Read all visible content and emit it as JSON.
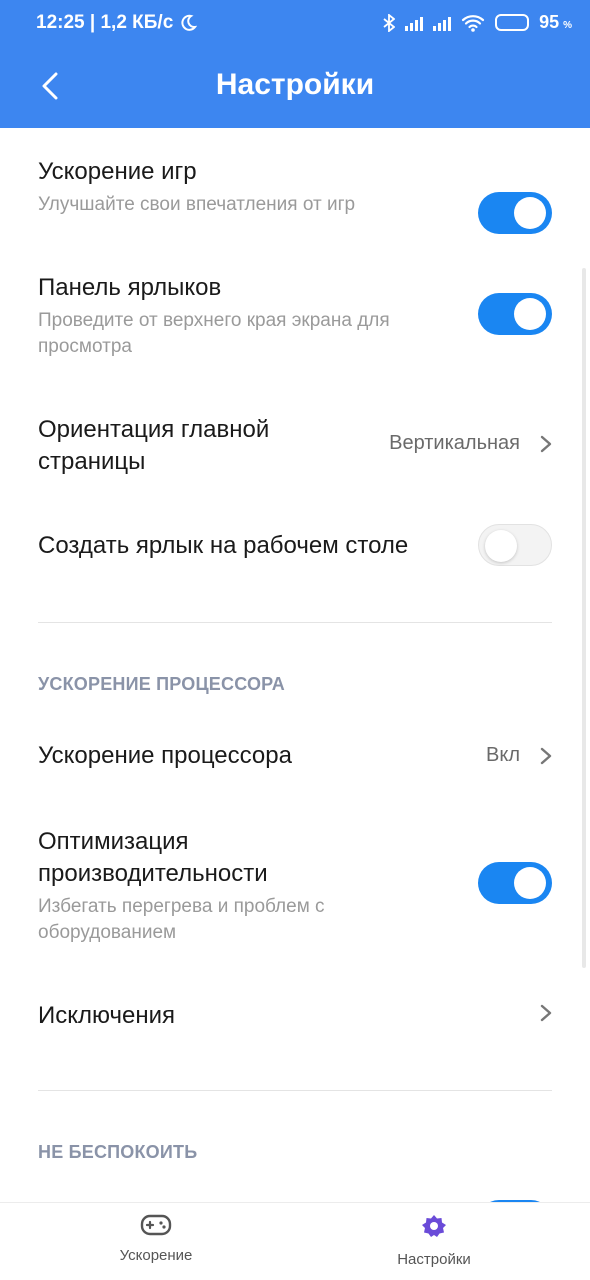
{
  "status_bar": {
    "time_speed": "12:25 | 1,2 КБ/с",
    "battery": "95",
    "battery_unit": "%"
  },
  "header": {
    "title": "Настройки"
  },
  "settings": [
    {
      "title": "Ускорение игр",
      "subtitle": "Улучшайте свои впечатления от игр",
      "toggle": true
    },
    {
      "title": "Панель ярлыков",
      "subtitle": "Проведите от верхнего края экрана для просмотра",
      "toggle": true
    },
    {
      "title": "Ориентация главной страницы",
      "value": "Вертикальная"
    },
    {
      "title": "Создать ярлык на рабочем столе",
      "toggle": false
    }
  ],
  "sections": {
    "cpu": "УСКОРЕНИЕ ПРОЦЕССОРА",
    "dnd": "НЕ БЕСПОКОИТЬ"
  },
  "cpu_settings": [
    {
      "title": "Ускорение процессора",
      "value": "Вкл"
    },
    {
      "title": "Оптимизация производительности",
      "subtitle": "Избегать перегрева и проблем с оборудованием",
      "toggle": true
    },
    {
      "title": "Исключения"
    }
  ],
  "bottom_nav": [
    {
      "label": "Ускорение",
      "icon": "gamepad-icon",
      "active": false
    },
    {
      "label": "Настройки",
      "icon": "gear-icon",
      "active": true,
      "color": "#6a4bd8"
    }
  ],
  "colors": {
    "header_bg": "#3d86f0",
    "toggle_on": "#1a86f2",
    "section_label": "#8a93a8"
  }
}
